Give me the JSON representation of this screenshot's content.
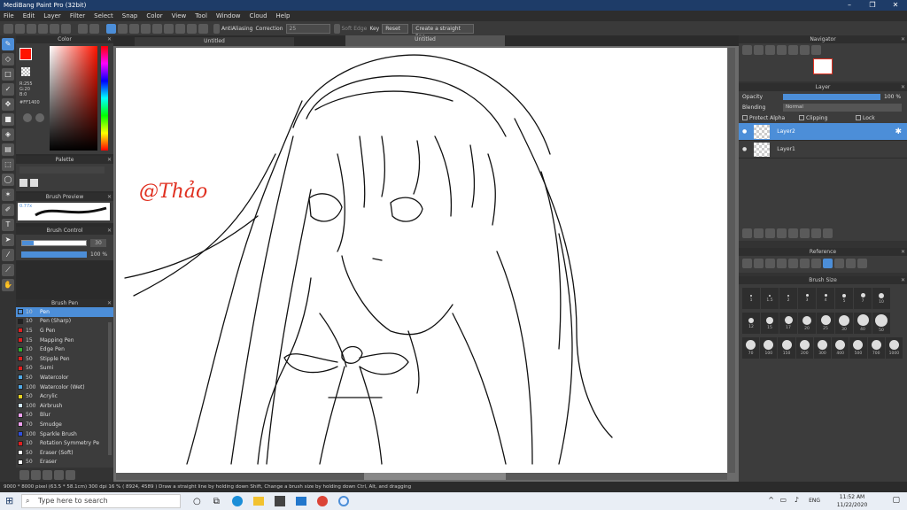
{
  "app": {
    "title": "MediBang Paint Pro (32bit)"
  },
  "window_controls": {
    "minimize": "–",
    "restore": "❐",
    "close": "✕"
  },
  "menu": [
    "File",
    "Edit",
    "Layer",
    "Filter",
    "Select",
    "Snap",
    "Color",
    "View",
    "Tool",
    "Window",
    "Cloud",
    "Help"
  ],
  "toolbar": {
    "antialias": "AntiAliasing",
    "correction_label": "Correction",
    "correction_value": "25",
    "soft_edge": "Soft Edge",
    "key": "Key",
    "reset": "Reset",
    "straight_line": "Create a straight line"
  },
  "tabs": [
    "Untitled",
    "Untitled"
  ],
  "color_panel": {
    "title": "Color",
    "r": "R:255",
    "g": "G:20",
    "b": "B:0",
    "hex": "#FF1400",
    "primary": "#ff1400",
    "secondary": "#ffffff"
  },
  "palette_panel": {
    "title": "Palette"
  },
  "brush_preview": {
    "title": "Brush Preview",
    "size": "0.77x"
  },
  "brush_control": {
    "title": "Brush Control",
    "size_value": "30",
    "opacity_value": "100 %"
  },
  "brush_list": {
    "title": "Brush Pen",
    "items": [
      {
        "size": "10",
        "name": "Pen",
        "color": "#4c8ed8"
      },
      {
        "size": "10",
        "name": "Pen (Sharp)",
        "color": "#222222"
      },
      {
        "size": "15",
        "name": "G Pen",
        "color": "#e02020"
      },
      {
        "size": "15",
        "name": "Mapping Pen",
        "color": "#e02020"
      },
      {
        "size": "10",
        "name": "Edge Pen",
        "color": "#30b030"
      },
      {
        "size": "50",
        "name": "Stipple Pen",
        "color": "#e02020"
      },
      {
        "size": "50",
        "name": "Sumi",
        "color": "#e02020"
      },
      {
        "size": "50",
        "name": "Watercolor",
        "color": "#4fa8e8"
      },
      {
        "size": "100",
        "name": "Watercolor (Wet)",
        "color": "#4fa8e8"
      },
      {
        "size": "50",
        "name": "Acrylic",
        "color": "#e8d020"
      },
      {
        "size": "100",
        "name": "Airbrush",
        "color": "#cfe8ff"
      },
      {
        "size": "50",
        "name": "Blur",
        "color": "#f0a0f0"
      },
      {
        "size": "70",
        "name": "Smudge",
        "color": "#f0a0f0"
      },
      {
        "size": "100",
        "name": "Sparkle Brush",
        "color": "#3050e0"
      },
      {
        "size": "10",
        "name": "Rotation Symmetry Pe",
        "color": "#e02020"
      },
      {
        "size": "50",
        "name": "Eraser (Soft)",
        "color": "#ffffff"
      },
      {
        "size": "50",
        "name": "Eraser",
        "color": "#ffffff"
      }
    ]
  },
  "canvas": {
    "signature": "@Thảo"
  },
  "navigator": {
    "title": "Navigator"
  },
  "layer_panel": {
    "title": "Layer",
    "opacity_label": "Opacity",
    "opacity_value": "100 %",
    "blending_label": "Blending",
    "blending_value": "Normal",
    "protect_alpha": "Protect Alpha",
    "clipping": "Clipping",
    "lock": "Lock",
    "layers": [
      {
        "name": "Layer2",
        "selected": true
      },
      {
        "name": "Layer1",
        "selected": false
      }
    ]
  },
  "reference_panel": {
    "title": "Reference"
  },
  "brush_size_panel": {
    "title": "Brush Size",
    "row1": [
      "·",
      "·",
      "·",
      "·",
      "•",
      "•",
      "•",
      "●"
    ],
    "row1_labels": [
      "1",
      "1.5",
      "2",
      "3",
      "4",
      "5",
      "7",
      "10"
    ],
    "row2_labels": [
      "12",
      "15",
      "17",
      "20",
      "25",
      "30",
      "40",
      "50"
    ],
    "row3_labels": [
      "70",
      "100",
      "150",
      "200",
      "300",
      "400",
      "500",
      "700",
      "1000"
    ]
  },
  "statusbar": "9000 * 8000 pixel  (63.5 * 58.1cm)  300 dpi  16 %  ( 8924, 4589 )  Draw a straight line by holding down Shift, Change a brush size by holding down Ctrl, Alt, and dragging",
  "taskbar": {
    "search_placeholder": "Type here to search",
    "time": "11:52 AM",
    "date": "11/22/2020",
    "lang": "ENG"
  }
}
